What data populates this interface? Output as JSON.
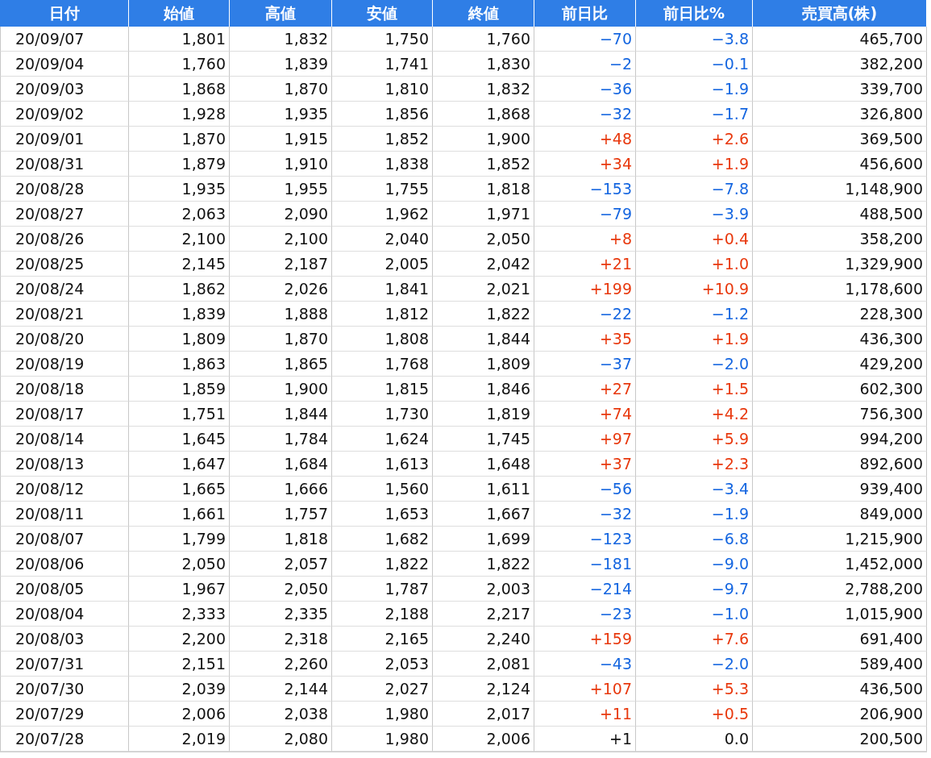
{
  "table": {
    "columns": [
      "日付",
      "始値",
      "高値",
      "安値",
      "終値",
      "前日比",
      "前日比%",
      "売買高(株)"
    ],
    "rows": [
      {
        "date": "20/09/07",
        "open": "1,801",
        "high": "1,832",
        "low": "1,750",
        "close": "1,760",
        "change": "−70",
        "change_pct": "−3.8",
        "volume": "465,700",
        "color": "#1566e0"
      },
      {
        "date": "20/09/04",
        "open": "1,760",
        "high": "1,839",
        "low": "1,741",
        "close": "1,830",
        "change": "−2",
        "change_pct": "−0.1",
        "volume": "382,200",
        "color": "#1566e0"
      },
      {
        "date": "20/09/03",
        "open": "1,868",
        "high": "1,870",
        "low": "1,810",
        "close": "1,832",
        "change": "−36",
        "change_pct": "−1.9",
        "volume": "339,700",
        "color": "#1566e0"
      },
      {
        "date": "20/09/02",
        "open": "1,928",
        "high": "1,935",
        "low": "1,856",
        "close": "1,868",
        "change": "−32",
        "change_pct": "−1.7",
        "volume": "326,800",
        "color": "#1566e0"
      },
      {
        "date": "20/09/01",
        "open": "1,870",
        "high": "1,915",
        "low": "1,852",
        "close": "1,900",
        "change": "+48",
        "change_pct": "+2.6",
        "volume": "369,500",
        "color": "#e8380d"
      },
      {
        "date": "20/08/31",
        "open": "1,879",
        "high": "1,910",
        "low": "1,838",
        "close": "1,852",
        "change": "+34",
        "change_pct": "+1.9",
        "volume": "456,600",
        "color": "#e8380d"
      },
      {
        "date": "20/08/28",
        "open": "1,935",
        "high": "1,955",
        "low": "1,755",
        "close": "1,818",
        "change": "−153",
        "change_pct": "−7.8",
        "volume": "1,148,900",
        "color": "#1566e0"
      },
      {
        "date": "20/08/27",
        "open": "2,063",
        "high": "2,090",
        "low": "1,962",
        "close": "1,971",
        "change": "−79",
        "change_pct": "−3.9",
        "volume": "488,500",
        "color": "#1566e0"
      },
      {
        "date": "20/08/26",
        "open": "2,100",
        "high": "2,100",
        "low": "2,040",
        "close": "2,050",
        "change": "+8",
        "change_pct": "+0.4",
        "volume": "358,200",
        "color": "#e8380d"
      },
      {
        "date": "20/08/25",
        "open": "2,145",
        "high": "2,187",
        "low": "2,005",
        "close": "2,042",
        "change": "+21",
        "change_pct": "+1.0",
        "volume": "1,329,900",
        "color": "#e8380d"
      },
      {
        "date": "20/08/24",
        "open": "1,862",
        "high": "2,026",
        "low": "1,841",
        "close": "2,021",
        "change": "+199",
        "change_pct": "+10.9",
        "volume": "1,178,600",
        "color": "#e8380d"
      },
      {
        "date": "20/08/21",
        "open": "1,839",
        "high": "1,888",
        "low": "1,812",
        "close": "1,822",
        "change": "−22",
        "change_pct": "−1.2",
        "volume": "228,300",
        "color": "#1566e0"
      },
      {
        "date": "20/08/20",
        "open": "1,809",
        "high": "1,870",
        "low": "1,808",
        "close": "1,844",
        "change": "+35",
        "change_pct": "+1.9",
        "volume": "436,300",
        "color": "#e8380d"
      },
      {
        "date": "20/08/19",
        "open": "1,863",
        "high": "1,865",
        "low": "1,768",
        "close": "1,809",
        "change": "−37",
        "change_pct": "−2.0",
        "volume": "429,200",
        "color": "#1566e0"
      },
      {
        "date": "20/08/18",
        "open": "1,859",
        "high": "1,900",
        "low": "1,815",
        "close": "1,846",
        "change": "+27",
        "change_pct": "+1.5",
        "volume": "602,300",
        "color": "#e8380d"
      },
      {
        "date": "20/08/17",
        "open": "1,751",
        "high": "1,844",
        "low": "1,730",
        "close": "1,819",
        "change": "+74",
        "change_pct": "+4.2",
        "volume": "756,300",
        "color": "#e8380d"
      },
      {
        "date": "20/08/14",
        "open": "1,645",
        "high": "1,784",
        "low": "1,624",
        "close": "1,745",
        "change": "+97",
        "change_pct": "+5.9",
        "volume": "994,200",
        "color": "#e8380d"
      },
      {
        "date": "20/08/13",
        "open": "1,647",
        "high": "1,684",
        "low": "1,613",
        "close": "1,648",
        "change": "+37",
        "change_pct": "+2.3",
        "volume": "892,600",
        "color": "#e8380d"
      },
      {
        "date": "20/08/12",
        "open": "1,665",
        "high": "1,666",
        "low": "1,560",
        "close": "1,611",
        "change": "−56",
        "change_pct": "−3.4",
        "volume": "939,400",
        "color": "#1566e0"
      },
      {
        "date": "20/08/11",
        "open": "1,661",
        "high": "1,757",
        "low": "1,653",
        "close": "1,667",
        "change": "−32",
        "change_pct": "−1.9",
        "volume": "849,000",
        "color": "#1566e0"
      },
      {
        "date": "20/08/07",
        "open": "1,799",
        "high": "1,818",
        "low": "1,682",
        "close": "1,699",
        "change": "−123",
        "change_pct": "−6.8",
        "volume": "1,215,900",
        "color": "#1566e0"
      },
      {
        "date": "20/08/06",
        "open": "2,050",
        "high": "2,057",
        "low": "1,822",
        "close": "1,822",
        "change": "−181",
        "change_pct": "−9.0",
        "volume": "1,452,000",
        "color": "#1566e0"
      },
      {
        "date": "20/08/05",
        "open": "1,967",
        "high": "2,050",
        "low": "1,787",
        "close": "2,003",
        "change": "−214",
        "change_pct": "−9.7",
        "volume": "2,788,200",
        "color": "#1566e0"
      },
      {
        "date": "20/08/04",
        "open": "2,333",
        "high": "2,335",
        "low": "2,188",
        "close": "2,217",
        "change": "−23",
        "change_pct": "−1.0",
        "volume": "1,015,900",
        "color": "#1566e0"
      },
      {
        "date": "20/08/03",
        "open": "2,200",
        "high": "2,318",
        "low": "2,165",
        "close": "2,240",
        "change": "+159",
        "change_pct": "+7.6",
        "volume": "691,400",
        "color": "#e8380d"
      },
      {
        "date": "20/07/31",
        "open": "2,151",
        "high": "2,260",
        "low": "2,053",
        "close": "2,081",
        "change": "−43",
        "change_pct": "−2.0",
        "volume": "589,400",
        "color": "#1566e0"
      },
      {
        "date": "20/07/30",
        "open": "2,039",
        "high": "2,144",
        "low": "2,027",
        "close": "2,124",
        "change": "+107",
        "change_pct": "+5.3",
        "volume": "436,500",
        "color": "#e8380d"
      },
      {
        "date": "20/07/29",
        "open": "2,006",
        "high": "2,038",
        "low": "1,980",
        "close": "2,017",
        "change": "+11",
        "change_pct": "+0.5",
        "volume": "206,900",
        "color": "#e8380d"
      },
      {
        "date": "20/07/28",
        "open": "2,019",
        "high": "2,080",
        "low": "1,980",
        "close": "2,006",
        "change": "+1",
        "change_pct": "0.0",
        "volume": "200,500",
        "color": "#111111"
      }
    ]
  }
}
